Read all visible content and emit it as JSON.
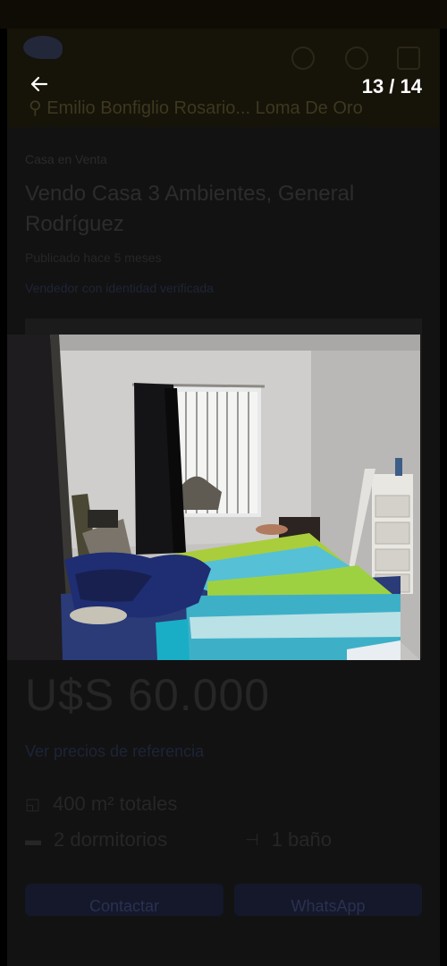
{
  "gallery": {
    "counter": "13 / 14",
    "back_icon": "arrow-left-icon",
    "photo_alt": "Bedroom with bed, blue and green comforter, window with dark curtain and white drawer unit"
  },
  "listing": {
    "location": "Emilio Bonfiglio Rosario... Loma De Oro",
    "category": "Casa en Venta",
    "title": "Vendo Casa 3 Ambientes, General Rodríguez",
    "published": "Publicado hace 5 meses",
    "seller": "Vendedor con identidad verificada",
    "price": "U$S 60.000",
    "reference_link": "Ver precios de referencia",
    "specs": {
      "area": "400 m² totales",
      "bedrooms": "2 dormitorios",
      "bathrooms": "1 baño"
    },
    "buttons": {
      "contact": "Contactar",
      "whatsapp": "WhatsApp"
    }
  },
  "colors": {
    "overlay_bg": "#121212",
    "counter_text": "#ffffff"
  }
}
